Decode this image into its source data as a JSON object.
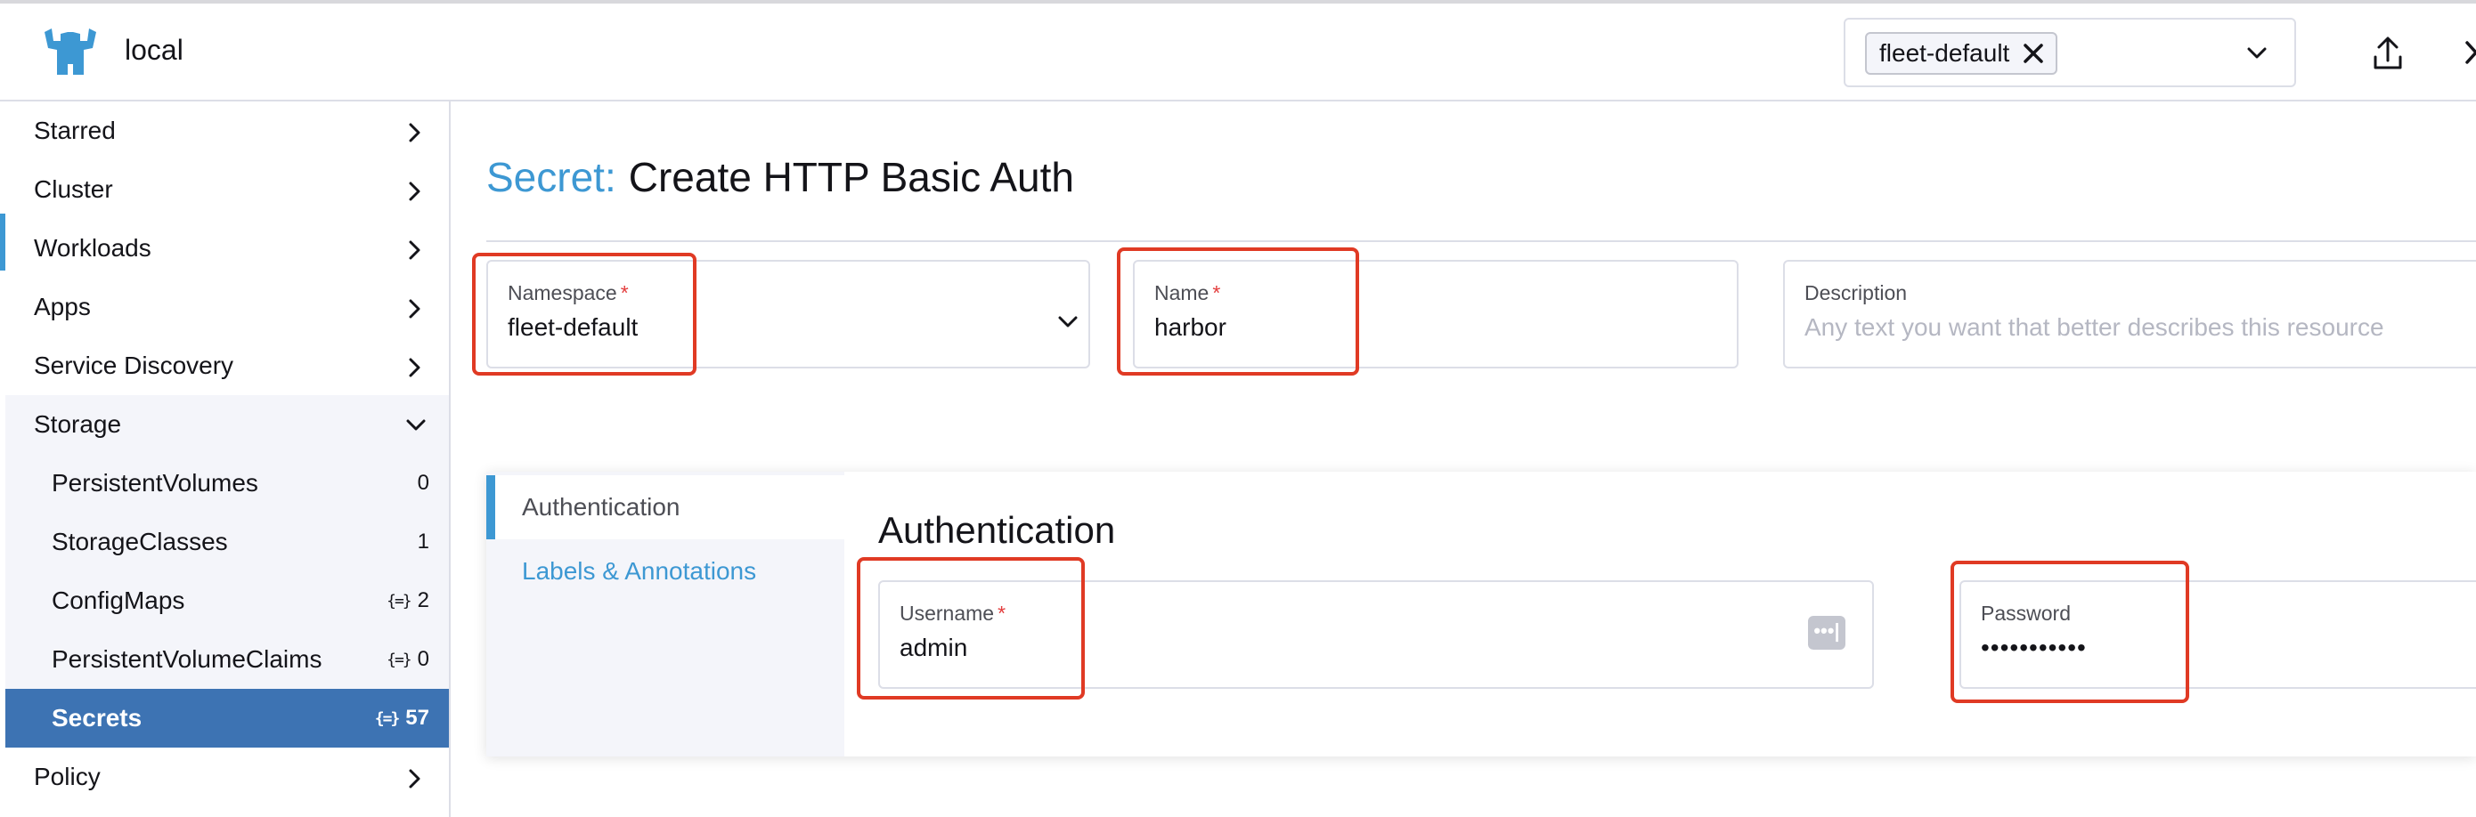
{
  "header": {
    "cluster_name": "local",
    "namespace_filter": {
      "selected": "fleet-default"
    }
  },
  "sidebar": {
    "items": [
      {
        "label": "Starred"
      },
      {
        "label": "Cluster"
      },
      {
        "label": "Workloads"
      },
      {
        "label": "Apps"
      },
      {
        "label": "Service Discovery"
      },
      {
        "label": "Storage"
      },
      {
        "label": "Policy"
      }
    ],
    "storage_children": [
      {
        "label": "PersistentVolumes",
        "count": "0"
      },
      {
        "label": "StorageClasses",
        "count": "1"
      },
      {
        "label": "ConfigMaps",
        "count": "2"
      },
      {
        "label": "PersistentVolumeClaims",
        "count": "0"
      },
      {
        "label": "Secrets",
        "count": "57"
      }
    ]
  },
  "page": {
    "title_type": "Secret:",
    "title_text": "Create HTTP Basic Auth"
  },
  "form": {
    "namespace": {
      "label": "Namespace",
      "required": "*",
      "value": "fleet-default"
    },
    "name": {
      "label": "Name",
      "required": "*",
      "value": "harbor"
    },
    "description": {
      "label": "Description",
      "placeholder": "Any text you want that better describes this resource"
    }
  },
  "tabs": [
    {
      "label": "Authentication"
    },
    {
      "label": "Labels & Annotations"
    }
  ],
  "auth": {
    "section_title": "Authentication",
    "username": {
      "label": "Username",
      "required": "*",
      "value": "admin"
    },
    "password": {
      "label": "Password",
      "value": "•••••••••••"
    },
    "dots_label": "•••|"
  },
  "colors": {
    "accent": "#3d98d3",
    "active_nav": "#3d73b3",
    "highlight": "#e03a24",
    "required": "#e33c3c"
  }
}
